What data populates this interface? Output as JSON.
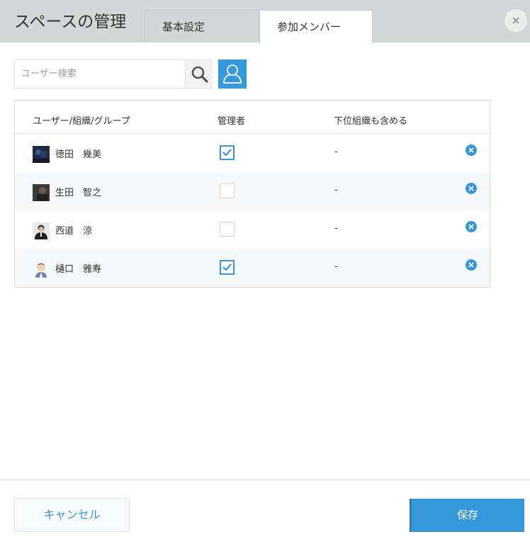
{
  "header": {
    "title": "スペースの管理",
    "tabs": [
      {
        "label": "基本設定",
        "active": false
      },
      {
        "label": "参加メンバー",
        "active": true
      }
    ],
    "close_icon": "close-icon"
  },
  "search": {
    "placeholder": "ユーザー検索",
    "value": ""
  },
  "table": {
    "columns": [
      "ユーザー/組織/グループ",
      "管理者",
      "下位組織も含める"
    ],
    "rows": [
      {
        "name": "徳田　幾美",
        "admin": true,
        "sub": "-"
      },
      {
        "name": "生田　智之",
        "admin": false,
        "sub": "-"
      },
      {
        "name": "西道　涼",
        "admin": false,
        "sub": "-"
      },
      {
        "name": "樋口　雅寿",
        "admin": true,
        "sub": "-"
      }
    ]
  },
  "footer": {
    "cancel_label": "キャンセル",
    "save_label": "保存"
  },
  "colors": {
    "accent": "#3498db",
    "header_bg": "#d4d7d7"
  }
}
